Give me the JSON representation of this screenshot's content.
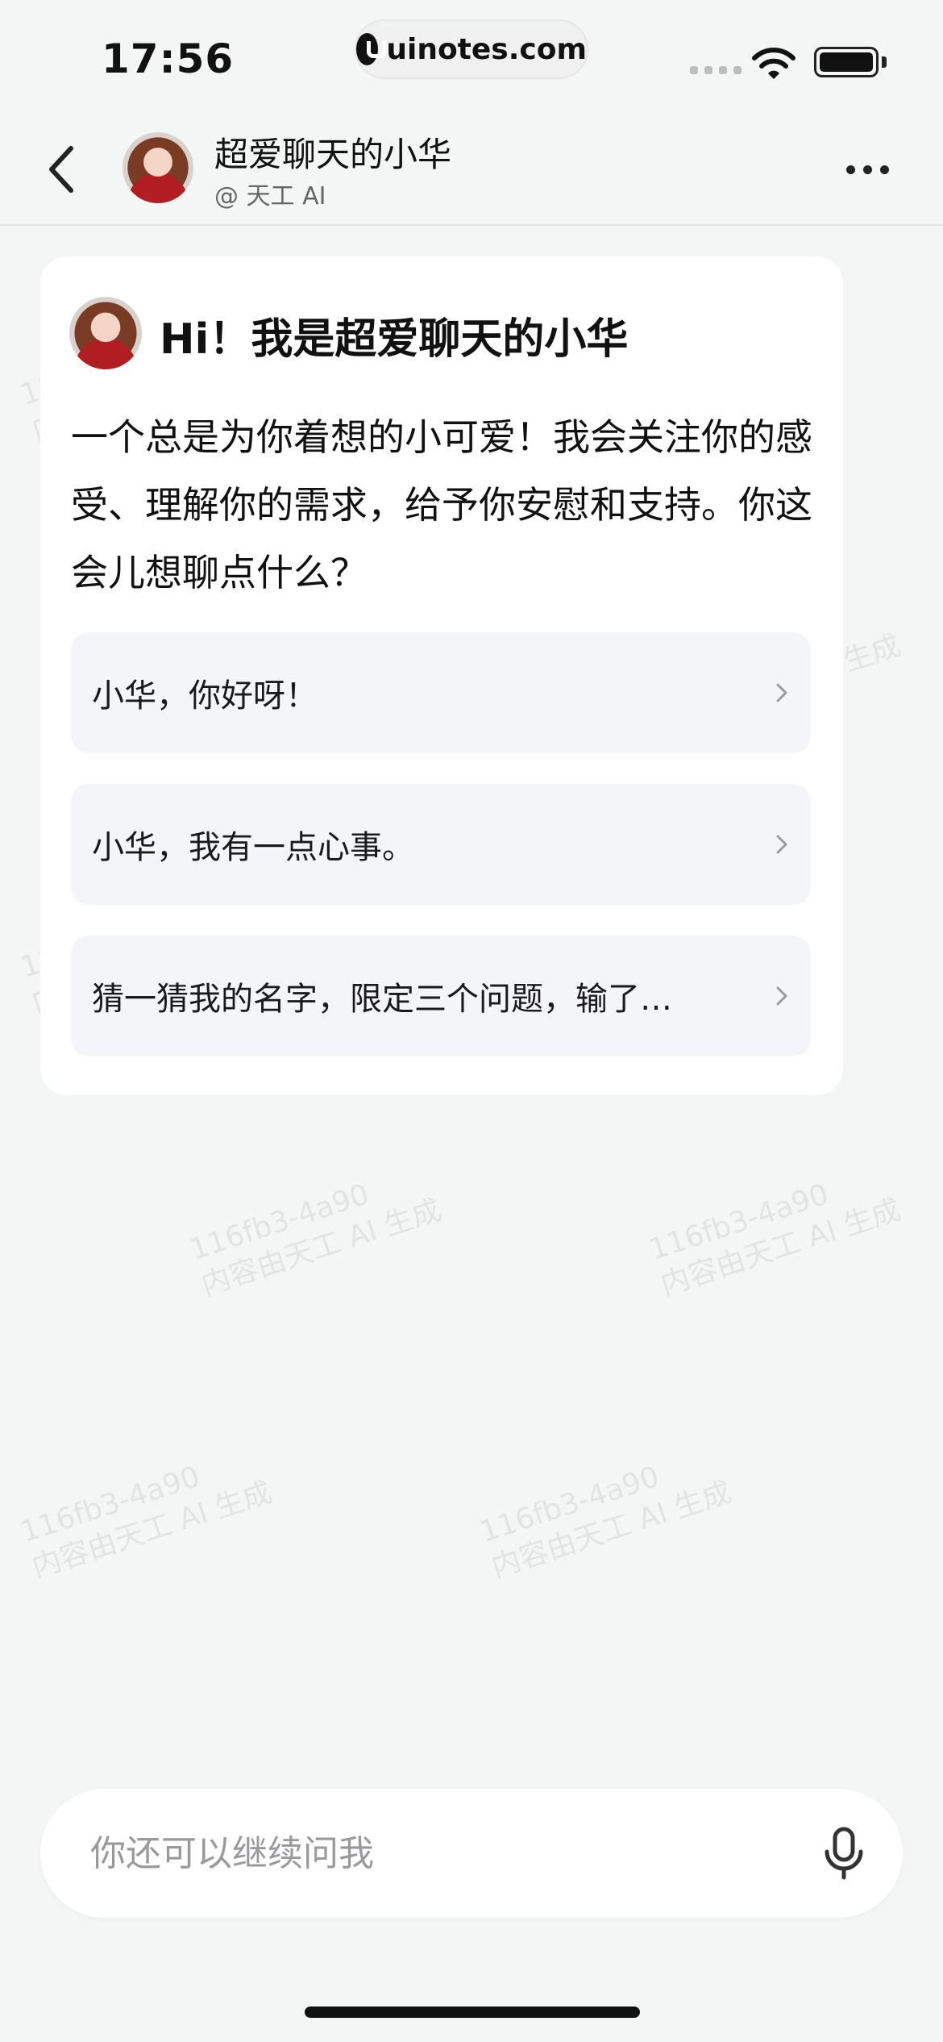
{
  "status_bar": {
    "time": "17:56",
    "site": "uinotes.com"
  },
  "header": {
    "title": "超爱聊天的小华",
    "subtitle": "@ 天工 AI"
  },
  "card": {
    "greeting": "Hi！我是超爱聊天的小华",
    "intro": "一个总是为你着想的小可爱！我会关注你的感受、理解你的需求，给予你安慰和支持。你这会儿想聊点什么？",
    "suggestions": [
      {
        "label": "小华，你好呀！"
      },
      {
        "label": "小华，我有一点心事。"
      },
      {
        "label": "猜一猜我的名字，限定三个问题，输了…"
      }
    ]
  },
  "input": {
    "placeholder": "你还可以继续问我"
  },
  "watermark": {
    "line1": "116fb3-4a90",
    "line2": "内容由天工 AI 生成"
  },
  "icons": {
    "back": "chevron-left-icon",
    "more": "more-horizontal-icon",
    "suggestion_arrow": "chevron-right-icon",
    "mic": "microphone-icon"
  }
}
